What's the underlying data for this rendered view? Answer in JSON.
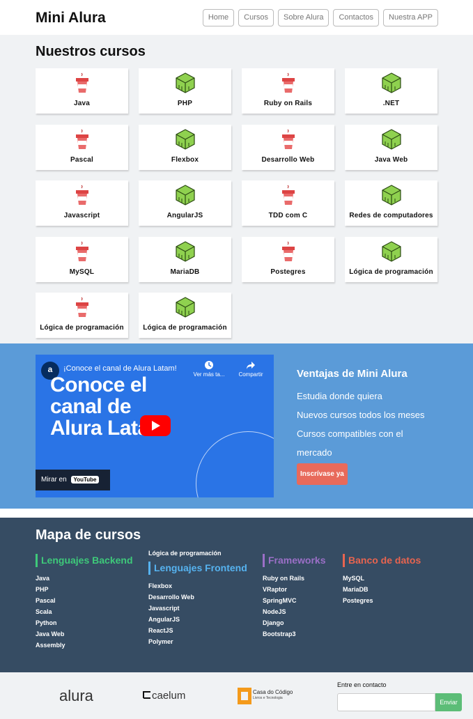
{
  "header": {
    "title": "Mini Alura",
    "nav": [
      "Home",
      "Cursos",
      "Sobre Alura",
      "Contactos",
      "Nuestra APP"
    ]
  },
  "courses": {
    "title": "Nuestros cursos",
    "items": [
      {
        "label": "Java",
        "icon": "coffee-cup-icon"
      },
      {
        "label": "PHP",
        "icon": "cube-icon"
      },
      {
        "label": "Ruby on Rails",
        "icon": "coffee-cup-icon"
      },
      {
        "label": ".NET",
        "icon": "cube-icon"
      },
      {
        "label": "Pascal",
        "icon": "coffee-cup-icon"
      },
      {
        "label": "Flexbox",
        "icon": "cube-icon"
      },
      {
        "label": "Desarrollo Web",
        "icon": "coffee-cup-icon"
      },
      {
        "label": "Java Web",
        "icon": "cube-icon"
      },
      {
        "label": "Javascript",
        "icon": "coffee-cup-icon"
      },
      {
        "label": "AngularJS",
        "icon": "cube-icon"
      },
      {
        "label": "TDD com C",
        "icon": "coffee-cup-icon"
      },
      {
        "label": "Redes de computadores",
        "icon": "cube-icon"
      },
      {
        "label": "MySQL",
        "icon": "coffee-cup-icon"
      },
      {
        "label": "MariaDB",
        "icon": "cube-icon"
      },
      {
        "label": "Postegres",
        "icon": "coffee-cup-icon"
      },
      {
        "label": "Lógica de programación",
        "icon": "cube-icon"
      },
      {
        "label": "Lógica de programación",
        "icon": "coffee-cup-icon"
      },
      {
        "label": "Lógica de programación",
        "icon": "cube-icon"
      }
    ]
  },
  "video": {
    "channel_avatar": "a",
    "title": "¡Conoce el canal de Alura Latam!",
    "big_line1": "Conoce el",
    "big_line2": "canal de",
    "big_line3": "Alura Lata",
    "watch_later": "Ver más ta...",
    "share": "Compartir",
    "watch_on": "Mirar en",
    "youtube": "YouTube"
  },
  "advantages": {
    "title": "Ventajas de Mini Alura",
    "items": [
      "Estudia donde quiera",
      "Nuevos cursos todos los meses",
      "Cursos compatibles con el mercado"
    ],
    "cta": "Inscrívase ya"
  },
  "map": {
    "title": "Mapa de cursos",
    "backend": {
      "title": "Lenguajes Backend",
      "color": "#3ec97a",
      "items": [
        "Java",
        "PHP",
        "Pascal",
        "Scala",
        "Python",
        "Java Web",
        "Assembly"
      ]
    },
    "frontend": {
      "extra": "Lógica de programación",
      "title": "Lenguajes Frontend",
      "color": "#56b3f0",
      "items": [
        "Flexbox",
        "Desarrollo Web",
        "Javascript",
        "AngularJS",
        "ReactJS",
        "Polymer"
      ]
    },
    "frameworks": {
      "title": "Frameworks",
      "color": "#9b6fc7",
      "items": [
        "Ruby on Rails",
        "VRaptor",
        "SpringMVC",
        "NodeJS",
        "Django",
        "Bootstrap3"
      ]
    },
    "databases": {
      "title": "Banco de datos",
      "color": "#e8644f",
      "items": [
        "MySQL",
        "MariaDB",
        "Postegres"
      ]
    }
  },
  "footer": {
    "brands": [
      "alura",
      "caelum",
      "Casa do Código"
    ],
    "brand_tagline": "Livros e Tecnologia",
    "contact_label": "Entre en contacto",
    "email_placeholder": "",
    "send_label": "Enviar"
  }
}
